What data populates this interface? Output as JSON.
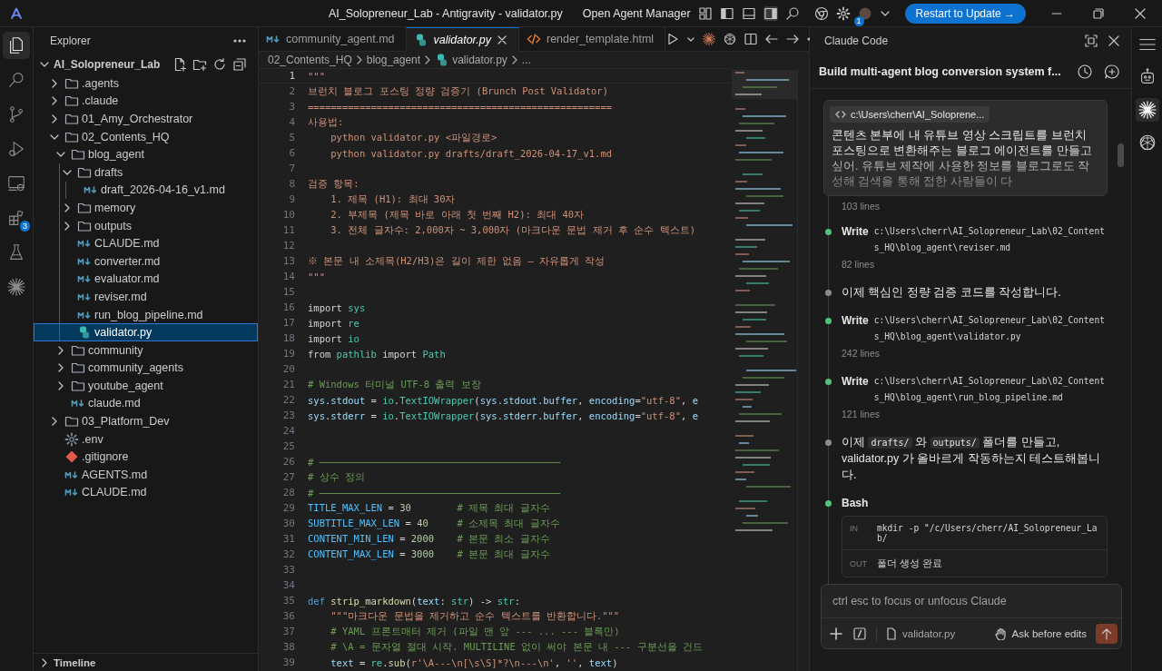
{
  "title_bar": {
    "window_title": "AI_Solopreneur_Lab - Antigravity - validator.py",
    "agent_manager": "Open Agent Manager",
    "account_badge": "1",
    "update_button": "Restart to Update →"
  },
  "activity_bar": [
    {
      "kind": "files",
      "selected": true
    },
    {
      "kind": "search",
      "selected": false
    },
    {
      "kind": "source-control",
      "selected": false
    },
    {
      "kind": "run",
      "selected": false
    },
    {
      "kind": "remote",
      "selected": false
    },
    {
      "kind": "extensions",
      "selected": false,
      "badge": "3"
    },
    {
      "kind": "testing",
      "selected": false
    },
    {
      "kind": "agent",
      "selected": false
    }
  ],
  "explorer": {
    "title": "Explorer",
    "root": {
      "label": "AI_Solopreneur_Lab",
      "expanded": true,
      "children": [
        {
          "label": ".agents",
          "kind": "folder",
          "expanded": false,
          "selected": false
        },
        {
          "label": ".claude",
          "kind": "folder",
          "expanded": false,
          "selected": false
        },
        {
          "label": "01_Amy_Orchestrator",
          "kind": "folder",
          "expanded": false,
          "selected": false
        },
        {
          "label": "02_Contents_HQ",
          "kind": "folder",
          "expanded": true,
          "selected": false,
          "children": [
            {
              "label": "blog_agent",
              "kind": "folder",
              "expanded": true,
              "selected": false,
              "children": [
                {
                  "label": "drafts",
                  "kind": "folder",
                  "expanded": true,
                  "selected": false,
                  "children": [
                    {
                      "label": "draft_2026-04-16_v1.md",
                      "kind": "markdown",
                      "selected": false
                    }
                  ]
                },
                {
                  "label": "memory",
                  "kind": "folder",
                  "expanded": false,
                  "selected": false
                },
                {
                  "label": "outputs",
                  "kind": "folder",
                  "expanded": false,
                  "selected": false
                },
                {
                  "label": "CLAUDE.md",
                  "kind": "markdown",
                  "selected": false
                },
                {
                  "label": "converter.md",
                  "kind": "markdown",
                  "selected": false
                },
                {
                  "label": "evaluator.md",
                  "kind": "markdown",
                  "selected": false
                },
                {
                  "label": "reviser.md",
                  "kind": "markdown",
                  "selected": false
                },
                {
                  "label": "run_blog_pipeline.md",
                  "kind": "markdown",
                  "selected": false
                },
                {
                  "label": "validator.py",
                  "kind": "python",
                  "selected": true
                }
              ]
            },
            {
              "label": "community",
              "kind": "folder",
              "expanded": false,
              "selected": false
            },
            {
              "label": "community_agents",
              "kind": "folder",
              "expanded": false,
              "selected": false
            },
            {
              "label": "youtube_agent",
              "kind": "folder",
              "expanded": false,
              "selected": false
            },
            {
              "label": "claude.md",
              "kind": "markdown",
              "selected": false
            }
          ]
        },
        {
          "label": "03_Platform_Dev",
          "kind": "folder",
          "expanded": false,
          "selected": false
        },
        {
          "label": ".env",
          "kind": "settings",
          "selected": false
        },
        {
          "label": ".gitignore",
          "kind": "git",
          "selected": false
        },
        {
          "label": "AGENTS.md",
          "kind": "markdown",
          "selected": false
        },
        {
          "label": "CLAUDE.md",
          "kind": "markdown",
          "selected": false
        }
      ]
    },
    "timeline": {
      "label": "Timeline",
      "expanded": false
    }
  },
  "editor": {
    "tabs": [
      {
        "label": "community_agent.md",
        "kind": "markdown",
        "selected": false
      },
      {
        "label": "validator.py",
        "kind": "python",
        "selected": true
      },
      {
        "label": "render_template.html",
        "kind": "html",
        "selected": false
      }
    ],
    "breadcrumb": [
      {
        "label": "02_Contents_HQ",
        "kind": "folder"
      },
      {
        "label": "blog_agent",
        "kind": "folder"
      },
      {
        "label": "validator.py",
        "kind": "python"
      },
      {
        "label": "...",
        "kind": "more"
      }
    ],
    "lines": [
      {
        "number": "1",
        "current": true,
        "tokens": [
          {
            "kind": "string",
            "text": "\"\"\""
          }
        ]
      },
      {
        "number": "2",
        "current": false,
        "tokens": [
          {
            "kind": "string",
            "text": "브런치 블로그 포스팅 정량 검증기 (Brunch Post Validator)"
          }
        ]
      },
      {
        "number": "3",
        "current": false,
        "tokens": [
          {
            "kind": "string",
            "text": "====================================================="
          }
        ]
      },
      {
        "number": "4",
        "current": false,
        "tokens": [
          {
            "kind": "string",
            "text": "사용법:"
          }
        ]
      },
      {
        "number": "5",
        "current": false,
        "tokens": [
          {
            "kind": "string",
            "text": "    python validator.py <파일경로>"
          }
        ]
      },
      {
        "number": "6",
        "current": false,
        "tokens": [
          {
            "kind": "string",
            "text": "    python validator.py drafts/draft_2026-04-17_v1.md"
          }
        ]
      },
      {
        "number": "7",
        "current": false
      },
      {
        "number": "8",
        "current": false,
        "tokens": [
          {
            "kind": "string",
            "text": "검증 항목:"
          }
        ]
      },
      {
        "number": "9",
        "current": false,
        "tokens": [
          {
            "kind": "string",
            "text": "    1. 제목 (H1): 최대 30자"
          }
        ]
      },
      {
        "number": "10",
        "current": false,
        "tokens": [
          {
            "kind": "string",
            "text": "    2. 부제목 (제목 바로 아래 첫 번째 H2): 최대 40자"
          }
        ]
      },
      {
        "number": "11",
        "current": false,
        "tokens": [
          {
            "kind": "string",
            "text": "    3. 전체 글자수: 2,000자 ~ 3,000자 (마크다운 문법 제거 후 순수 텍스트)"
          }
        ]
      },
      {
        "number": "12",
        "current": false
      },
      {
        "number": "13",
        "current": false,
        "tokens": [
          {
            "kind": "string",
            "text": "※ 본문 내 소제목(H2/H3)은 길이 제한 없음 — 자유롭게 작성"
          }
        ]
      },
      {
        "number": "14",
        "current": false,
        "tokens": [
          {
            "kind": "string",
            "text": "\"\"\""
          }
        ]
      },
      {
        "number": "15",
        "current": false
      },
      {
        "number": "16",
        "current": false,
        "tokens": [
          {
            "kind": "plain",
            "text": "import "
          },
          {
            "kind": "module",
            "text": "sys"
          }
        ]
      },
      {
        "number": "17",
        "current": false,
        "tokens": [
          {
            "kind": "plain",
            "text": "import "
          },
          {
            "kind": "module",
            "text": "re"
          }
        ]
      },
      {
        "number": "18",
        "current": false,
        "tokens": [
          {
            "kind": "plain",
            "text": "import "
          },
          {
            "kind": "module",
            "text": "io"
          }
        ]
      },
      {
        "number": "19",
        "current": false,
        "tokens": [
          {
            "kind": "plain",
            "text": "from "
          },
          {
            "kind": "module",
            "text": "pathlib"
          },
          {
            "kind": "plain",
            "text": " import "
          },
          {
            "kind": "module",
            "text": "Path"
          }
        ]
      },
      {
        "number": "20",
        "current": false
      },
      {
        "number": "21",
        "current": false,
        "tokens": [
          {
            "kind": "comment",
            "text": "# Windows 터미널 UTF-8 출력 보장"
          }
        ]
      },
      {
        "number": "22",
        "current": false,
        "tokens": [
          {
            "kind": "variable",
            "text": "sys.stdout"
          },
          {
            "kind": "plain",
            "text": " = "
          },
          {
            "kind": "module",
            "text": "io"
          },
          {
            "kind": "plain",
            "text": "."
          },
          {
            "kind": "module",
            "text": "TextIOWrapper"
          },
          {
            "kind": "plain",
            "text": "("
          },
          {
            "kind": "variable",
            "text": "sys.stdout.buffer"
          },
          {
            "kind": "plain",
            "text": ", "
          },
          {
            "kind": "variable",
            "text": "encoding"
          },
          {
            "kind": "plain",
            "text": "="
          },
          {
            "kind": "string",
            "text": "\"utf-8\""
          },
          {
            "kind": "plain",
            "text": ", "
          },
          {
            "kind": "variable",
            "text": "e"
          }
        ]
      },
      {
        "number": "23",
        "current": false,
        "tokens": [
          {
            "kind": "variable",
            "text": "sys.stderr"
          },
          {
            "kind": "plain",
            "text": " = "
          },
          {
            "kind": "module",
            "text": "io"
          },
          {
            "kind": "plain",
            "text": "."
          },
          {
            "kind": "module",
            "text": "TextIOWrapper"
          },
          {
            "kind": "plain",
            "text": "("
          },
          {
            "kind": "variable",
            "text": "sys.stderr.buffer"
          },
          {
            "kind": "plain",
            "text": ", "
          },
          {
            "kind": "variable",
            "text": "encoding"
          },
          {
            "kind": "plain",
            "text": "="
          },
          {
            "kind": "string",
            "text": "\"utf-8\""
          },
          {
            "kind": "plain",
            "text": ", "
          },
          {
            "kind": "variable",
            "text": "e"
          }
        ]
      },
      {
        "number": "24",
        "current": false
      },
      {
        "number": "25",
        "current": false
      },
      {
        "number": "26",
        "current": false,
        "tokens": [
          {
            "kind": "comment",
            "text": "# ──────────────────────────────────────────"
          }
        ]
      },
      {
        "number": "27",
        "current": false,
        "tokens": [
          {
            "kind": "comment",
            "text": "# 상수 정의"
          }
        ]
      },
      {
        "number": "28",
        "current": false,
        "tokens": [
          {
            "kind": "comment",
            "text": "# ──────────────────────────────────────────"
          }
        ]
      },
      {
        "number": "29",
        "current": false,
        "tokens": [
          {
            "kind": "constant",
            "text": "TITLE_MAX_LEN"
          },
          {
            "kind": "plain",
            "text": " = "
          },
          {
            "kind": "number",
            "text": "30"
          },
          {
            "kind": "comment",
            "text": "        # 제목 최대 글자수"
          }
        ]
      },
      {
        "number": "30",
        "current": false,
        "tokens": [
          {
            "kind": "constant",
            "text": "SUBTITLE_MAX_LEN"
          },
          {
            "kind": "plain",
            "text": " = "
          },
          {
            "kind": "number",
            "text": "40"
          },
          {
            "kind": "comment",
            "text": "     # 소제목 최대 글자수"
          }
        ]
      },
      {
        "number": "31",
        "current": false,
        "tokens": [
          {
            "kind": "constant",
            "text": "CONTENT_MIN_LEN"
          },
          {
            "kind": "plain",
            "text": " = "
          },
          {
            "kind": "number",
            "text": "2000"
          },
          {
            "kind": "comment",
            "text": "    # 본문 최소 글자수"
          }
        ]
      },
      {
        "number": "32",
        "current": false,
        "tokens": [
          {
            "kind": "constant",
            "text": "CONTENT_MAX_LEN"
          },
          {
            "kind": "plain",
            "text": " = "
          },
          {
            "kind": "number",
            "text": "3000"
          },
          {
            "kind": "comment",
            "text": "    # 본문 최대 글자수"
          }
        ]
      },
      {
        "number": "33",
        "current": false
      },
      {
        "number": "34",
        "current": false
      },
      {
        "number": "35",
        "current": false,
        "tokens": [
          {
            "kind": "keyword",
            "text": "def "
          },
          {
            "kind": "function",
            "text": "strip_markdown"
          },
          {
            "kind": "plain",
            "text": "("
          },
          {
            "kind": "variable",
            "text": "text"
          },
          {
            "kind": "plain",
            "text": ": "
          },
          {
            "kind": "module",
            "text": "str"
          },
          {
            "kind": "plain",
            "text": ") -> "
          },
          {
            "kind": "module",
            "text": "str"
          },
          {
            "kind": "plain",
            "text": ":"
          }
        ]
      },
      {
        "number": "36",
        "current": false,
        "tokens": [
          {
            "kind": "string",
            "text": "    \"\"\"마크다운 문법을 제거하고 순수 텍스트를 반환합니다.\"\"\""
          }
        ]
      },
      {
        "number": "37",
        "current": false,
        "tokens": [
          {
            "kind": "comment",
            "text": "    # YAML 프론트매터 제거 (파일 맨 앞 --- ... --- 블록만)"
          }
        ]
      },
      {
        "number": "38",
        "current": false,
        "tokens": [
          {
            "kind": "comment",
            "text": "    # \\A = 문자열 절대 시작. MULTILINE 없이 써야 본문 내 --- 구분선을 건드"
          }
        ]
      },
      {
        "number": "39",
        "current": false,
        "tokens": [
          {
            "kind": "variable",
            "text": "    text"
          },
          {
            "kind": "plain",
            "text": " = "
          },
          {
            "kind": "module",
            "text": "re"
          },
          {
            "kind": "plain",
            "text": "."
          },
          {
            "kind": "function",
            "text": "sub"
          },
          {
            "kind": "plain",
            "text": "("
          },
          {
            "kind": "string",
            "text": "r'\\A---\\n[\\s\\S]*?\\n---\\n'"
          },
          {
            "kind": "plain",
            "text": ", "
          },
          {
            "kind": "string",
            "text": "''"
          },
          {
            "kind": "plain",
            "text": ", "
          },
          {
            "kind": "variable",
            "text": "text"
          },
          {
            "kind": "plain",
            "text": ")"
          }
        ]
      }
    ]
  },
  "claude": {
    "header": "Claude Code",
    "session_title": "Build multi-agent blog conversion system f...",
    "prompt": {
      "file": "c:\\Users\\cherr\\AI_Soloprene...",
      "text": "콘텐츠 본부에 내 유튜브 영상 스크립트를 브런치 포스팅으로 변환해주는 블로그 에이전트를 만들고 싶어. 유튜브 제작에 사용한 정보를 블로그로도 작성해 검색을 통해 접한 사람들이 다"
    },
    "previous_line_count": "103 lines",
    "events": [
      {
        "kind": "tool",
        "color": "#4fc37a",
        "name": "Write",
        "path": "c:\\Users\\cherr\\AI_Solopreneur_Lab\\02_Contents_HQ\\blog_agent\\reviser.md",
        "lines": "82 lines"
      },
      {
        "kind": "message",
        "color": "#8c8c8c",
        "parts": [
          {
            "kind": "plain",
            "text": "이제 핵심인 정량 검증 코드를 작성합니다."
          }
        ]
      },
      {
        "kind": "tool",
        "color": "#4fc37a",
        "name": "Write",
        "path": "c:\\Users\\cherr\\AI_Solopreneur_Lab\\02_Contents_HQ\\blog_agent\\validator.py",
        "lines": "242 lines"
      },
      {
        "kind": "tool",
        "color": "#4fc37a",
        "name": "Write",
        "path": "c:\\Users\\cherr\\AI_Solopreneur_Lab\\02_Contents_HQ\\blog_agent\\run_blog_pipeline.md",
        "lines": "121 lines"
      },
      {
        "kind": "message",
        "color": "#8c8c8c",
        "parts": [
          {
            "kind": "plain",
            "text": "이제 "
          },
          {
            "kind": "code",
            "text": "drafts/"
          },
          {
            "kind": "plain",
            "text": " 와 "
          },
          {
            "kind": "code",
            "text": "outputs/"
          },
          {
            "kind": "plain",
            "text": " 폴더를 만들고, validator.py 가 올바르게 작동하는지 테스트해봅니다."
          }
        ]
      },
      {
        "kind": "command",
        "color": "#4fc37a",
        "name": "Bash",
        "input_label": "IN",
        "input": "mkdir -p \"/c/Users/cherr/AI_Solopreneur_Lab/",
        "output_label": "OUT",
        "output": "폴더 생성 완료"
      }
    ],
    "composer": {
      "placeholder": "ctrl esc to focus or unfocus Claude",
      "file": "validator.py",
      "mode": "Ask before edits"
    }
  },
  "side_rail": [
    {
      "kind": "menu",
      "selected": false
    },
    {
      "kind": "robot",
      "selected": false
    },
    {
      "kind": "agent",
      "selected": true
    },
    {
      "kind": "knot",
      "selected": false
    }
  ]
}
